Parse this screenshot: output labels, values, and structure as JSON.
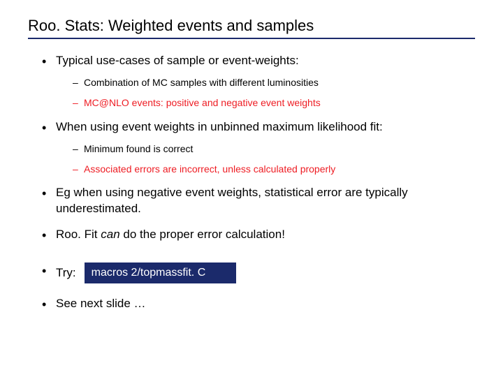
{
  "title": "Roo. Stats: Weighted events and samples",
  "bullets": {
    "b1": "Typical use-cases of sample or event-weights:",
    "b1_sub": {
      "s1": "Combination of MC samples with different luminosities",
      "s2": "MC@NLO events: positive and negative event weights"
    },
    "b2": "When using event weights in unbinned maximum likelihood fit:",
    "b2_sub": {
      "s1": "Minimum found is correct",
      "s2": "Associated errors are incorrect, unless calculated properly"
    },
    "b3": "Eg when using negative event weights, statistical error are typically underestimated.",
    "b4_pre": "Roo. Fit ",
    "b4_em": "can",
    "b4_post": " do the proper error calculation!",
    "b5_label": "Try:",
    "b5_code": "macros 2/topmassfit. C",
    "b6": "See next slide …"
  }
}
